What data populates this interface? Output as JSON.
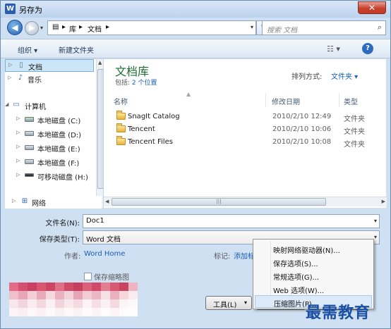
{
  "window": {
    "title": "另存为",
    "app_icon": "W",
    "close_glyph": "✕"
  },
  "address": {
    "crumbs": [
      "库",
      "文档"
    ],
    "separator": "▸",
    "search_placeholder": "搜索 文档"
  },
  "toolbar": {
    "organize": "组织 ▾",
    "new_folder": "新建文件夹",
    "view_glyph": "☷ ▾",
    "help_glyph": "?"
  },
  "nav": {
    "items": [
      {
        "label": "文档",
        "icon": "document-icon",
        "selected": true
      },
      {
        "label": "音乐",
        "icon": "music-icon"
      },
      {
        "label": "计算机",
        "icon": "computer-icon"
      },
      {
        "label": "本地磁盘 (C:)",
        "icon": "windows-drive-icon"
      },
      {
        "label": "本地磁盘 (D:)",
        "icon": "drive-icon"
      },
      {
        "label": "本地磁盘 (E:)",
        "icon": "drive-icon"
      },
      {
        "label": "本地磁盘 (F:)",
        "icon": "drive-icon"
      },
      {
        "label": "可移动磁盘 (H:)",
        "icon": "removable-drive-icon"
      },
      {
        "label": "网络",
        "icon": "network-icon"
      }
    ]
  },
  "library": {
    "title": "文档库",
    "includes_prefix": "包括: ",
    "includes_link": "2 个位置",
    "arrange_label": "排列方式:",
    "arrange_value": "文件夹 ▾"
  },
  "columns": {
    "name": "名称",
    "modified": "修改日期",
    "type": "类型"
  },
  "files": [
    {
      "name": "SnagIt Catalog",
      "date": "2010/2/10 12:49",
      "type": "文件夹"
    },
    {
      "name": "Tencent",
      "date": "2010/2/10 10:06",
      "type": "文件夹"
    },
    {
      "name": "Tencent Files",
      "date": "2010/2/10 10:08",
      "type": "文件夹"
    }
  ],
  "form": {
    "filename_label": "文件名(N):",
    "filename_value": "Doc1",
    "savetype_label": "保存类型(T):",
    "savetype_value": "Word 文档",
    "author_label": "作者:",
    "author_value": "Word Home",
    "tags_label": "标记:",
    "tags_value": "添加标",
    "thumbnail_label": "保存缩略图",
    "tools_label": "工具(L)"
  },
  "menu": {
    "items": [
      "映射网络驱动器(N)...",
      "保存选项(S)...",
      "常规选项(G)...",
      "Web 选项(W)...",
      "压缩图片(P)..."
    ],
    "hover_index": 4
  },
  "watermark": "最需教育"
}
